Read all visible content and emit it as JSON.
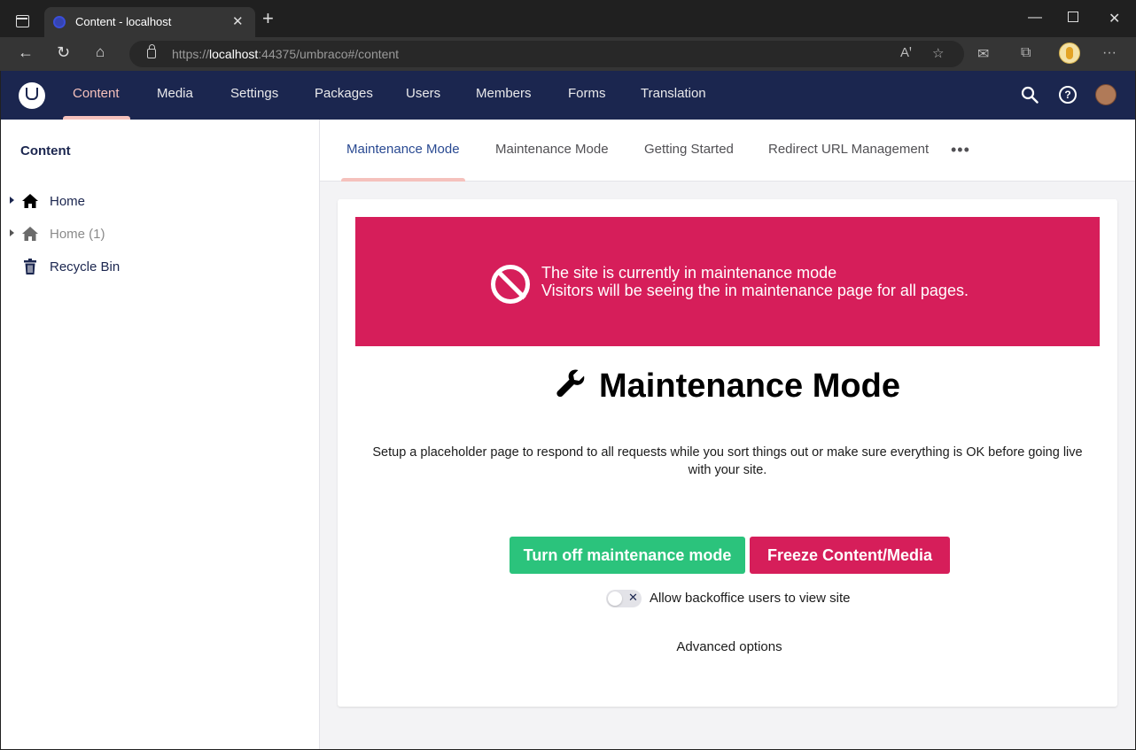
{
  "browser": {
    "tab_title": "Content - localhost",
    "url_prefix": "https://",
    "url_host": "localhost",
    "url_rest": ":44375/umbraco#/content"
  },
  "topnav": {
    "items": [
      "Content",
      "Media",
      "Settings",
      "Packages",
      "Users",
      "Members",
      "Forms",
      "Translation"
    ],
    "active": "Content"
  },
  "tree": {
    "title": "Content",
    "items": [
      {
        "label": "Home",
        "icon": "home-icon"
      },
      {
        "label": "Home (1)",
        "icon": "home-icon"
      },
      {
        "label": "Recycle Bin",
        "icon": "trash-icon"
      }
    ]
  },
  "dashboard": {
    "tabs": [
      "Maintenance Mode",
      "Maintenance Mode",
      "Getting Started",
      "Redirect URL Management"
    ],
    "more": "•••"
  },
  "banner": {
    "line1": "The site is currently in maintenance mode",
    "line2": "Visitors will be seeing the in maintenance page for all pages."
  },
  "maintenance": {
    "title": "Maintenance Mode",
    "description": "Setup a placeholder page to respond to all requests while you sort things out or make sure everything is OK before going live with your site.",
    "turn_off_button": "Turn off maintenance mode",
    "freeze_button": "Freeze Content/Media",
    "toggle_label": "Allow backoffice users to view site",
    "toggle_state": false,
    "advanced_label": "Advanced options"
  },
  "colors": {
    "header_bg": "#1b264f",
    "active_accent": "#f5c1bc",
    "banner_bg": "#d61e5a",
    "green_button": "#2bc37c"
  }
}
